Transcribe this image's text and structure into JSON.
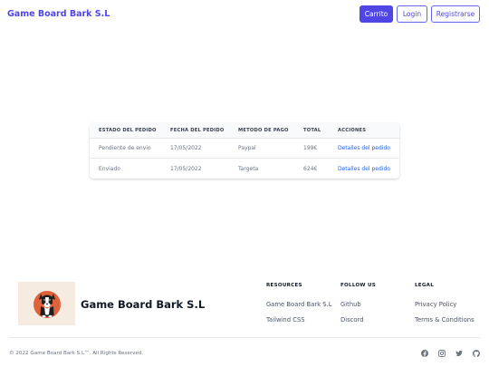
{
  "navbar": {
    "brand": "Game Board Bark S.L",
    "cart_label": "Carrito",
    "login_label": "Login",
    "register_label": "Registrarse"
  },
  "orders": {
    "headers": [
      "ESTADO DEL PEDIDO",
      "FECHA DEL PEDIDO",
      "METODO DE PAGO",
      "TOTAL",
      "ACCIONES"
    ],
    "rows": [
      {
        "status": "Pendiente de envio",
        "date": "17/05/2022",
        "payment": "Paypal",
        "total": "199€",
        "action": "Detalles del pedido"
      },
      {
        "status": "Enviado",
        "date": "17/05/2022",
        "payment": "Targeta",
        "total": "624€",
        "action": "Detalles del pedido"
      }
    ]
  },
  "footer": {
    "brand": "Game Board Bark S.L",
    "resources": {
      "title": "RESOURCES",
      "links": [
        "Game Board Bark S.L",
        "Tailwind CSS"
      ]
    },
    "follow": {
      "title": "FOLLOW US",
      "links": [
        "Github",
        "Discord"
      ]
    },
    "legal": {
      "title": "LEGAL",
      "links": [
        "Privacy Policy",
        "Terms & Conditions"
      ]
    },
    "copyright": "© 2022 Game Board Bark S.L™. All Rights Reserved.",
    "social_icons": [
      "facebook-icon",
      "instagram-icon",
      "twitter-icon",
      "github-icon"
    ]
  },
  "colors": {
    "accent": "#4f46e5",
    "link": "#2563eb",
    "logo_bg": "#f5ebe0",
    "logo_circle": "#e0623a"
  }
}
